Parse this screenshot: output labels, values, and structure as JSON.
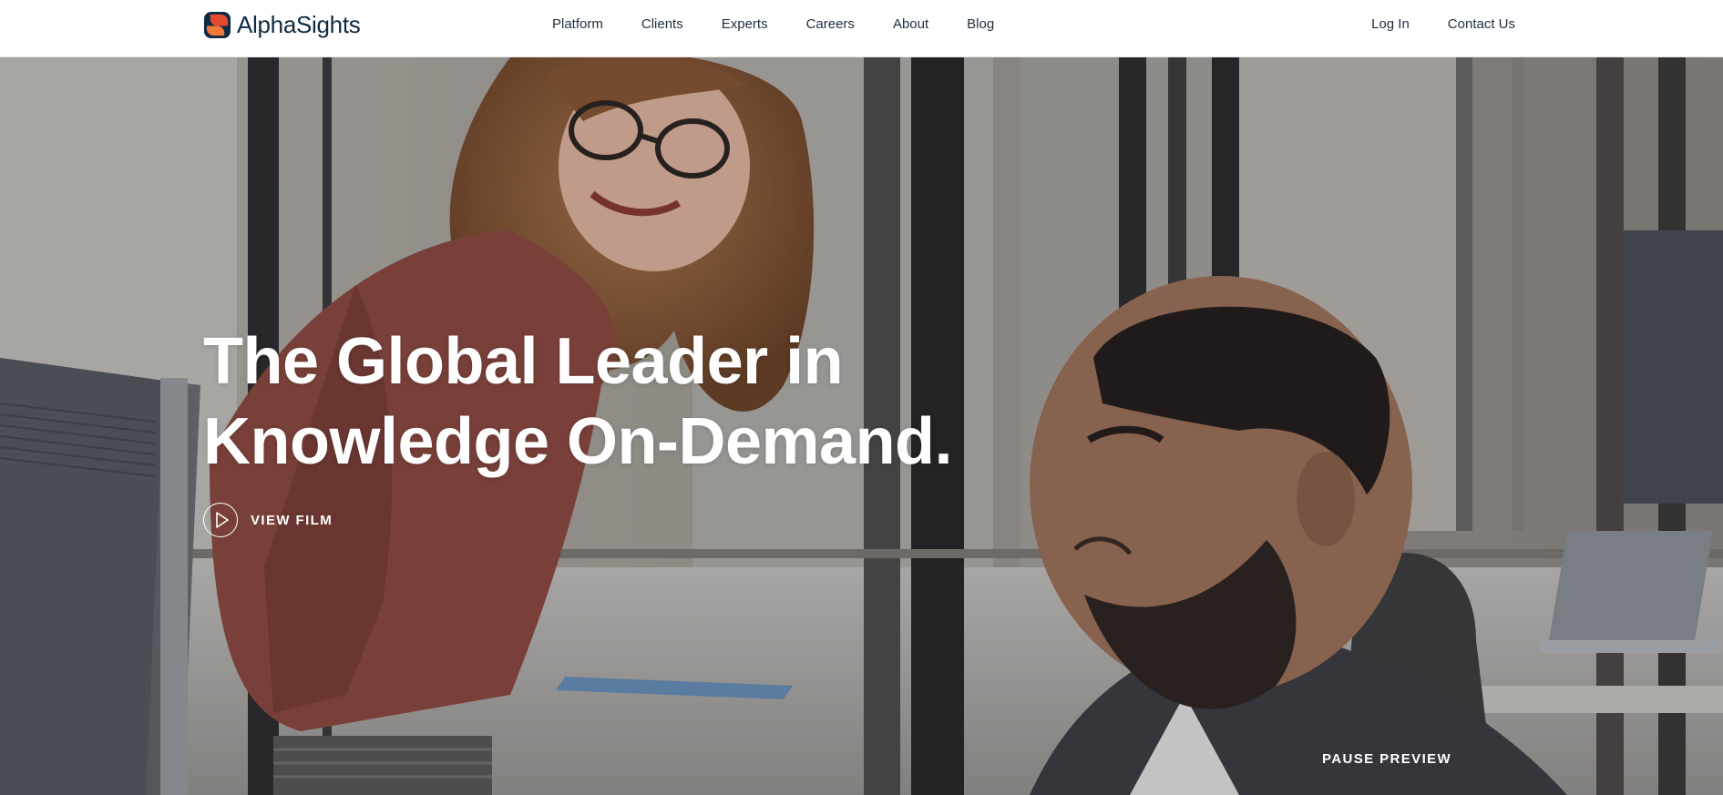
{
  "brand": {
    "name": "AlphaSights",
    "colors": {
      "logo_red": "#e2492f",
      "logo_orange": "#f0793a",
      "logo_navy": "#0f2a44",
      "nav_text": "#1f2d3d",
      "hero_text": "#ffffff"
    }
  },
  "nav": {
    "main": [
      {
        "label": "Platform"
      },
      {
        "label": "Clients"
      },
      {
        "label": "Experts"
      },
      {
        "label": "Careers"
      },
      {
        "label": "About"
      },
      {
        "label": "Blog"
      }
    ],
    "right": [
      {
        "label": "Log In"
      },
      {
        "label": "Contact Us"
      }
    ]
  },
  "hero": {
    "headline_line1": "The Global Leader in",
    "headline_line2": "Knowledge On-Demand.",
    "cta": {
      "label": "VIEW FILM",
      "icon": "play-icon"
    },
    "video_control": {
      "label": "PAUSE PREVIEW"
    },
    "background": "office-video-still"
  }
}
